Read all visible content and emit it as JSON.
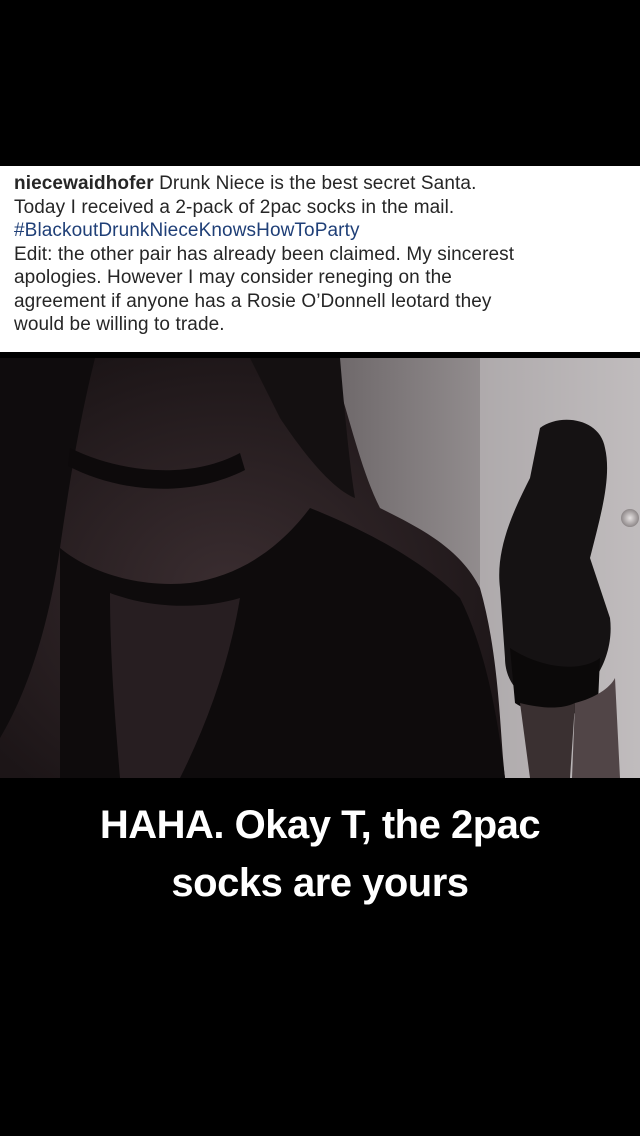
{
  "post": {
    "username": "niecewaidhofer",
    "caption_line1": " Drunk Niece is the best secret Santa.",
    "caption_line2": "Today I received a 2-pack of 2pac socks in the mail.",
    "hashtag": "#BlackoutDrunkNieceKnowsHowToParty",
    "edit_line1": "Edit: the other pair has already been claimed. My sincerest",
    "edit_line2": "apologies. However I may consider reneging on the",
    "edit_line3": "agreement if anyone has a Rosie O’Donnell leotard they",
    "edit_line4": "would be willing to trade."
  },
  "story": {
    "overlay_line1": "HAHA. Okay T, the 2pac",
    "overlay_line2": "socks are yours"
  },
  "colors": {
    "background": "#000000",
    "card": "#ffffff",
    "text": "#262626",
    "hashtag": "#1f3f77",
    "overlay_text": "#ffffff"
  }
}
